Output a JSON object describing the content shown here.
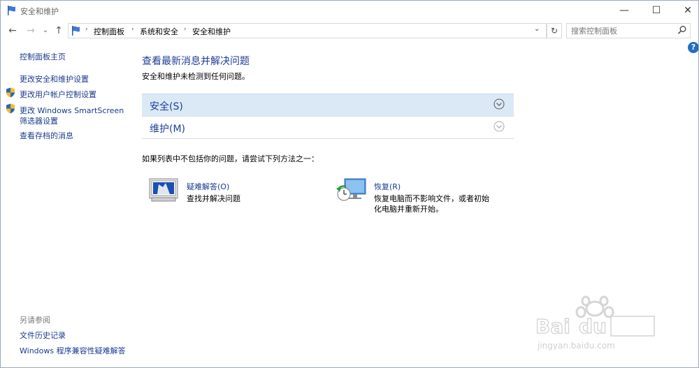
{
  "window": {
    "title": "安全和维护",
    "min_glyph": "—",
    "max_glyph": "☐",
    "close_glyph": "✕"
  },
  "nav": {
    "back_glyph": "←",
    "forward_glyph": "→",
    "recent_glyph": "⌄",
    "up_glyph": "↑",
    "breadcrumbs": [
      "控制面板",
      "系统和安全",
      "安全和维护"
    ],
    "separator": "›",
    "dropdown_glyph": "⌄",
    "refresh_glyph": "↻",
    "search_placeholder": "搜索控制面板",
    "help_glyph": "?"
  },
  "sidebar": {
    "home": "控制面板主页",
    "items": [
      "更改安全和维护设置",
      "更改用户帐户控制设置",
      "更改 Windows SmartScreen",
      "筛选器设置",
      "查看存档的消息"
    ],
    "see_also_title": "另请参阅",
    "see_also": [
      "文件历史记录",
      "Windows 程序兼容性疑难解答"
    ]
  },
  "main": {
    "title": "查看最新消息并解决问题",
    "subtitle": "安全和维护未检测到任何问题。",
    "sections": [
      "安全(S)",
      "维护(M)"
    ],
    "tip": "如果列表中不包括你的问题，请尝试下列方法之一：",
    "options": [
      {
        "title": "疑难解答(O)",
        "desc": "查找并解决问题",
        "icon": "troubleshoot-icon"
      },
      {
        "title": "恢复(R)",
        "desc": "恢复电脑而不影响文件，或者初始化电脑并重新开始。",
        "icon": "recovery-icon"
      }
    ]
  },
  "watermark": {
    "text": "jingyan.baidu.com"
  },
  "colors": {
    "link": "#1a3a8f",
    "heading": "#1e3e97",
    "section_highlight": "#dbe9f7"
  }
}
